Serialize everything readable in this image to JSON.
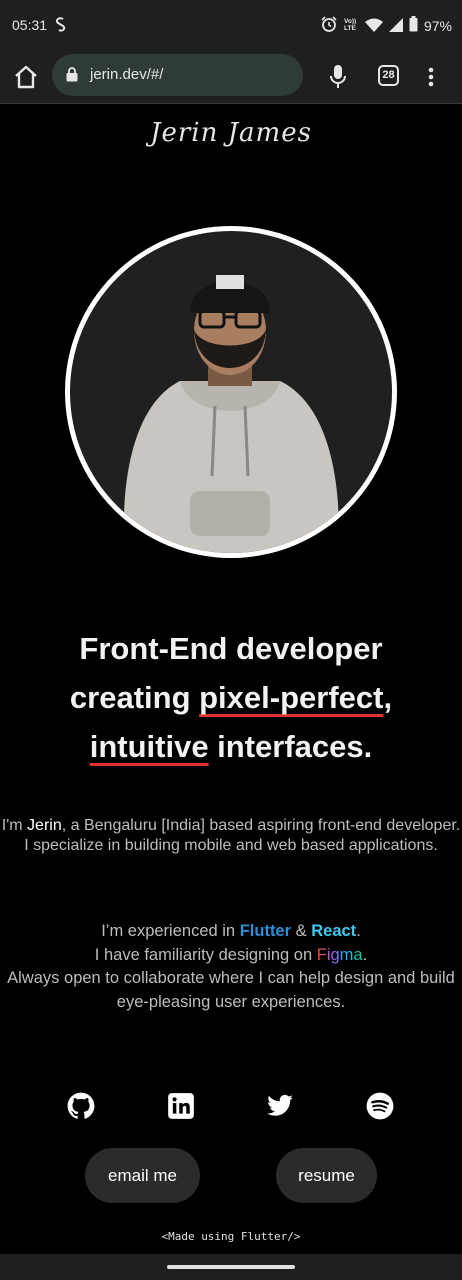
{
  "status_bar": {
    "time": "05:31",
    "battery": "97%",
    "icons": [
      "shazam-icon",
      "alarm-icon",
      "volte-icon",
      "wifi-icon",
      "signal-icon",
      "battery-icon"
    ]
  },
  "browser": {
    "url": "jerin.dev/#/",
    "tab_count": "28",
    "icons": [
      "home-icon",
      "lock-icon",
      "mic-icon",
      "tabs-icon",
      "more-vert-icon"
    ]
  },
  "page": {
    "signature": "Jerin James",
    "headline": {
      "line1": "Front-End developer",
      "line2_pre": "creating ",
      "line2_hl": "pixel-perfect",
      "line2_post": ",",
      "line3_hl": "intuitive",
      "line3_post": " interfaces."
    },
    "bio1": {
      "pre": "I'm ",
      "name": "Jerin",
      "post": ", a Bengaluru [India] based aspiring front-end developer.",
      "line2": "I specialize in building mobile and web based applications."
    },
    "bio2": {
      "l1_pre": "I’m experienced in ",
      "flutter": "Flutter",
      "amp": " & ",
      "react": "React",
      "l1_post": ".",
      "l2_pre": "I have familiarity designing on ",
      "figma": "Figma",
      "l2_post": ".",
      "l3": "Always open to collaborate where I can help design and build eye-pleasing user experiences."
    },
    "socials": [
      "github-icon",
      "linkedin-icon",
      "twitter-icon",
      "spotify-icon"
    ],
    "buttons": {
      "email": "email me",
      "resume": "resume"
    },
    "footer": "<Made using Flutter/>"
  },
  "colors": {
    "background": "#000000",
    "accent_underline": "#e0322e",
    "flutter": "#2b8fd8",
    "react": "#3ec9f0",
    "button_bg": "#2b2b2b"
  }
}
